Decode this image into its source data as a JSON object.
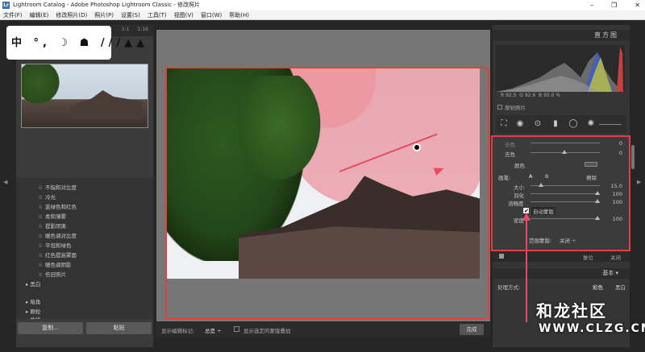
{
  "window": {
    "title": "Lightroom Catalog - Adobe Photoshop Lightroom Classic - 修改照片",
    "app_icon": "Lr"
  },
  "menu": [
    "文件(F)",
    "编辑(E)",
    "修改照片(D)",
    "照片(P)",
    "设置(S)",
    "工具(T)",
    "视图(V)",
    "窗口(W)",
    "帮助(H)"
  ],
  "navigator": {
    "zoom": [
      "1:1",
      "1:16"
    ]
  },
  "logo": {
    "glyphs": "中 °, ☽ ☗ ///▲▲"
  },
  "presets": {
    "items": [
      "不指和对比度",
      "冷光",
      "蓝绿色和红色",
      "柔和薄雾",
      "提影阴离",
      "暖色调对比度",
      "平坦和绿色",
      "红色提高雾面",
      "暖色调阴影",
      "伤旧照片"
    ],
    "folders": [
      "黑白",
      "暗角",
      "颗粒",
      "曲线"
    ]
  },
  "left_buttons": {
    "copy": "复制...",
    "paste": "粘贴"
  },
  "toolbar": {
    "show_label": "显示编辑标记:",
    "show_value": "总是 ÷",
    "overlay_label": "显示选定的蒙版叠加",
    "done": "完成"
  },
  "right": {
    "histogram_title": "直方图",
    "rgb": {
      "r_label": "R",
      "r": "92.5",
      "g_label": "G",
      "g": "92.6",
      "b_label": "B",
      "b": "95.0",
      "unit": "%"
    },
    "original_photo": "原始照片",
    "mask": {
      "row_a_label": "去色",
      "color_label": "颜色",
      "brush_label": "画笔:",
      "brush_a": "A",
      "brush_b": "B",
      "erase": "擦除",
      "size_label": "大小",
      "size_val": "15.0",
      "feather_label": "羽化",
      "feather_val": "100",
      "flow_label": "流畅度",
      "flow_val": "100",
      "automask_label": "自动蒙版",
      "density_label": "密度",
      "density_val": "100",
      "range_label": "范围蒙版:",
      "range_val": "关闭 ÷",
      "zero_1": "0",
      "zero_2": "0"
    },
    "footer": {
      "reset": "复位",
      "close": "关闭"
    },
    "basic_title": "基本",
    "treatment_label": "处理方式:",
    "color": "彩色",
    "bw": "黑白"
  },
  "watermark": {
    "text": "和龙社区",
    "url": "WWW.CLZG.CN"
  },
  "colors": {
    "highlight_red": "#e04040",
    "mask_pink": "#ec96a0"
  }
}
